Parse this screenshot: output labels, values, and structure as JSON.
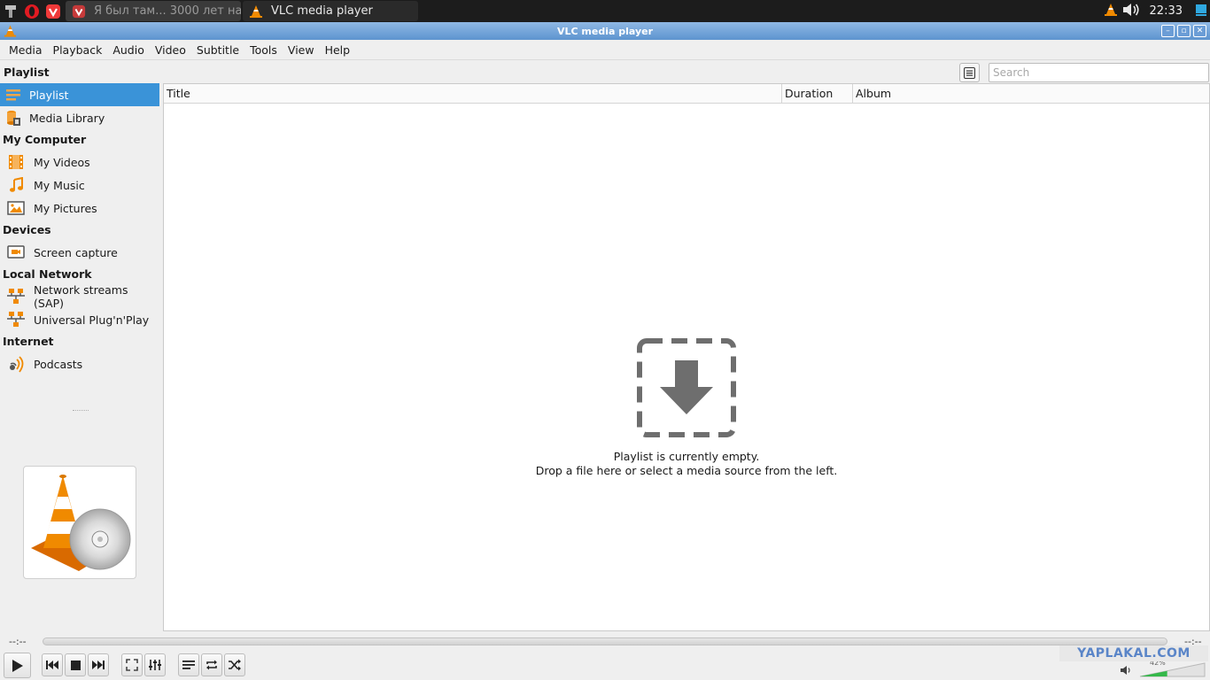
{
  "taskbar": {
    "tasks": [
      {
        "label": "Я был там... 3000 лет на...",
        "icon": "vivaldi-icon"
      },
      {
        "label": "VLC media player",
        "icon": "vlc-cone-icon"
      }
    ],
    "clock": "22:33"
  },
  "window": {
    "title": "VLC media player"
  },
  "menu": {
    "items": [
      {
        "label": "Media"
      },
      {
        "label": "Playback"
      },
      {
        "label": "Audio"
      },
      {
        "label": "Video"
      },
      {
        "label": "Subtitle"
      },
      {
        "label": "Tools"
      },
      {
        "label": "View"
      },
      {
        "label": "Help"
      }
    ]
  },
  "sidebar": {
    "playlist_head": "Playlist",
    "playlist": "Playlist",
    "media_library": "Media Library",
    "my_computer_head": "My Computer",
    "my_videos": "My Videos",
    "my_music": "My Music",
    "my_pictures": "My Pictures",
    "devices_head": "Devices",
    "screen_capture": "Screen capture",
    "local_network_head": "Local Network",
    "network_streams": "Network streams (SAP)",
    "upnp": "Universal Plug'n'Play",
    "internet_head": "Internet",
    "podcasts": "Podcasts"
  },
  "search": {
    "placeholder": "Search"
  },
  "playlist": {
    "columns": {
      "title": "Title",
      "duration": "Duration",
      "album": "Album"
    },
    "empty_line1": "Playlist is currently empty.",
    "empty_line2": "Drop a file here or select a media source from the left."
  },
  "controls": {
    "elapsed": "--:--",
    "remaining": "--:--",
    "volume_percent": "42%",
    "volume_level": 0.42
  },
  "watermark": "YAPLAKAL.COM",
  "colors": {
    "selection": "#3a93d8",
    "accent_orange": "#f08a00",
    "titlebar": "#6b9dd6"
  }
}
